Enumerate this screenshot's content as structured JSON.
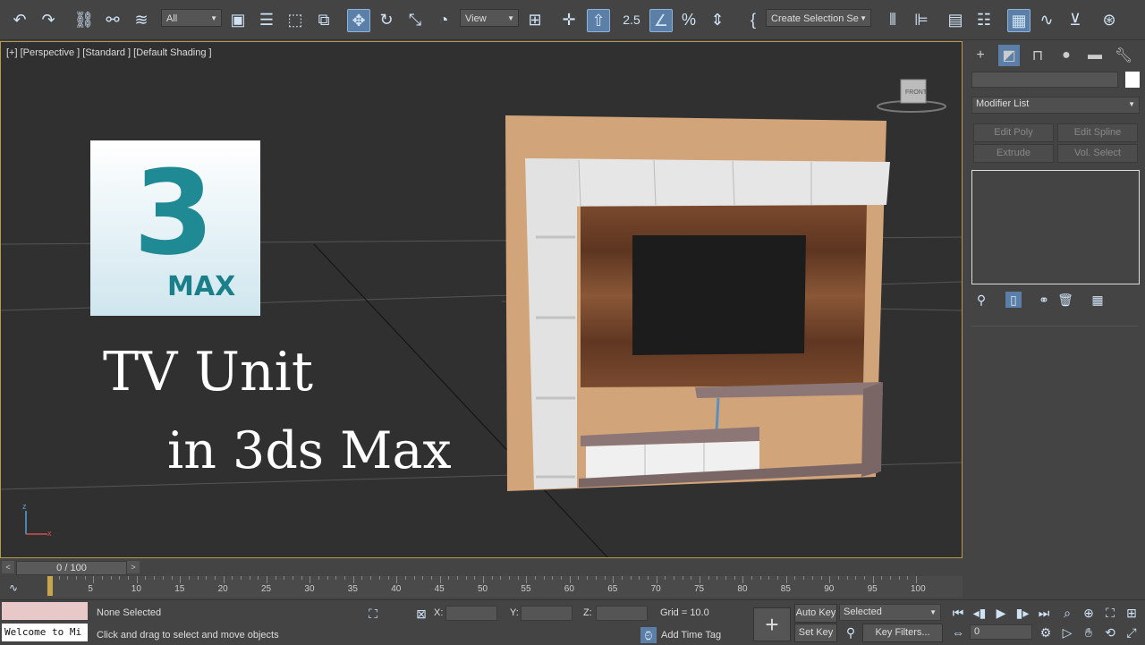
{
  "toolbar": {
    "filter_value": "All",
    "ref_coord_value": "View",
    "selection_set_value": "Create Selection Se",
    "snap_label": "2.5"
  },
  "viewport": {
    "label": "[+] [Perspective ] [Standard ] [Default Shading ]",
    "viewcube_label": "FRONT",
    "logo_text": "MAX",
    "title_line1": "TV Unit",
    "title_line2": "in 3ds Max"
  },
  "command_panel": {
    "name_value": "",
    "modifier_list": "Modifier List",
    "buttons": [
      "Edit Poly",
      "Edit Spline",
      "Extrude",
      "Vol. Select"
    ]
  },
  "timeline": {
    "frame_display": "0 / 100",
    "ticks": [
      "5",
      "10",
      "15",
      "20",
      "25",
      "30",
      "35",
      "40",
      "45",
      "50",
      "55",
      "60",
      "65",
      "70",
      "75",
      "80",
      "85",
      "90",
      "95",
      "100"
    ]
  },
  "status": {
    "maxscript_text": "Welcome to Mi",
    "selection_status": "None Selected",
    "prompt": "Click and drag to select and move objects",
    "x_label": "X:",
    "y_label": "Y:",
    "z_label": "Z:",
    "grid": "Grid = 10.0",
    "add_time_tag": "Add Time Tag",
    "auto_key": "Auto Key",
    "set_key": "Set Key",
    "selected_value": "Selected",
    "key_filters": "Key Filters...",
    "frame_value": "0"
  }
}
